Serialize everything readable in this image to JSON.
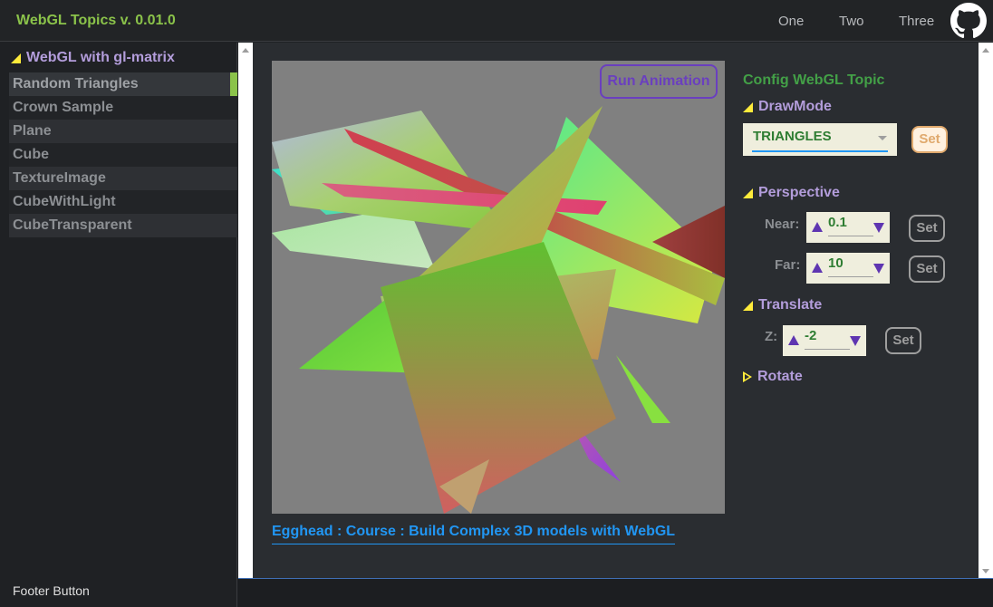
{
  "header": {
    "title": "WebGL Topics v. 0.01.0",
    "nav": [
      "One",
      "Two",
      "Three"
    ]
  },
  "sidebar": {
    "section": "WebGL with gl-matrix",
    "items": [
      {
        "label": "Random Triangles",
        "active": true
      },
      {
        "label": "Crown Sample"
      },
      {
        "label": "Plane"
      },
      {
        "label": "Cube"
      },
      {
        "label": "TextureImage"
      },
      {
        "label": "CubeWithLight"
      },
      {
        "label": "CubeTransparent"
      }
    ],
    "footer": "Footer Button"
  },
  "canvas": {
    "run_button": "Run Animation"
  },
  "course_link": "Egghead : Course : Build Complex 3D models with WebGL",
  "config": {
    "title": "Config WebGL Topic",
    "drawmode": {
      "heading": "DrawMode",
      "value": "TRIANGLES",
      "set": "Set"
    },
    "perspective": {
      "heading": "Perspective",
      "near_label": "Near:",
      "near_value": "0.1",
      "far_label": "Far:",
      "far_value": "10",
      "set": "Set"
    },
    "translate": {
      "heading": "Translate",
      "z_label": "Z:",
      "z_value": "-2",
      "set": "Set"
    },
    "rotate": {
      "heading": "Rotate"
    }
  },
  "colors": {
    "accent_green": "#8bc34a",
    "accent_purple": "#b39ddb",
    "link_blue": "#2196f3",
    "canvas_bg": "#808080"
  }
}
